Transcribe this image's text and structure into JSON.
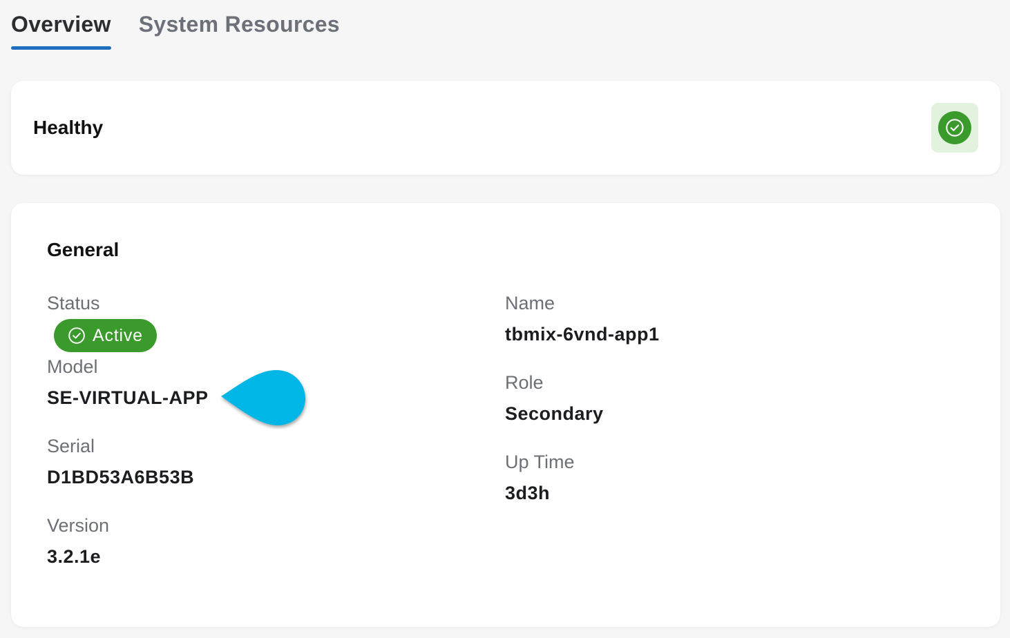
{
  "tabs": [
    {
      "label": "Overview",
      "active": true
    },
    {
      "label": "System Resources",
      "active": false
    }
  ],
  "health": {
    "title": "Healthy",
    "icon": "check-circle-icon",
    "color": "#3a9a2b"
  },
  "general": {
    "title": "General",
    "status": {
      "label": "Status",
      "value": "Active",
      "icon": "check-circle-icon"
    },
    "model": {
      "label": "Model",
      "value": "SE-VIRTUAL-APP"
    },
    "serial": {
      "label": "Serial",
      "value": "D1BD53A6B53B"
    },
    "version": {
      "label": "Version",
      "value": "3.2.1e"
    },
    "name": {
      "label": "Name",
      "value": "tbmix-6vnd-app1"
    },
    "role": {
      "label": "Role",
      "value": "Secondary"
    },
    "uptime": {
      "label": "Up Time",
      "value": "3d3h"
    }
  },
  "colors": {
    "accent": "#1f6ec0",
    "success": "#3a9a2b",
    "pointer": "#00b6e6"
  }
}
